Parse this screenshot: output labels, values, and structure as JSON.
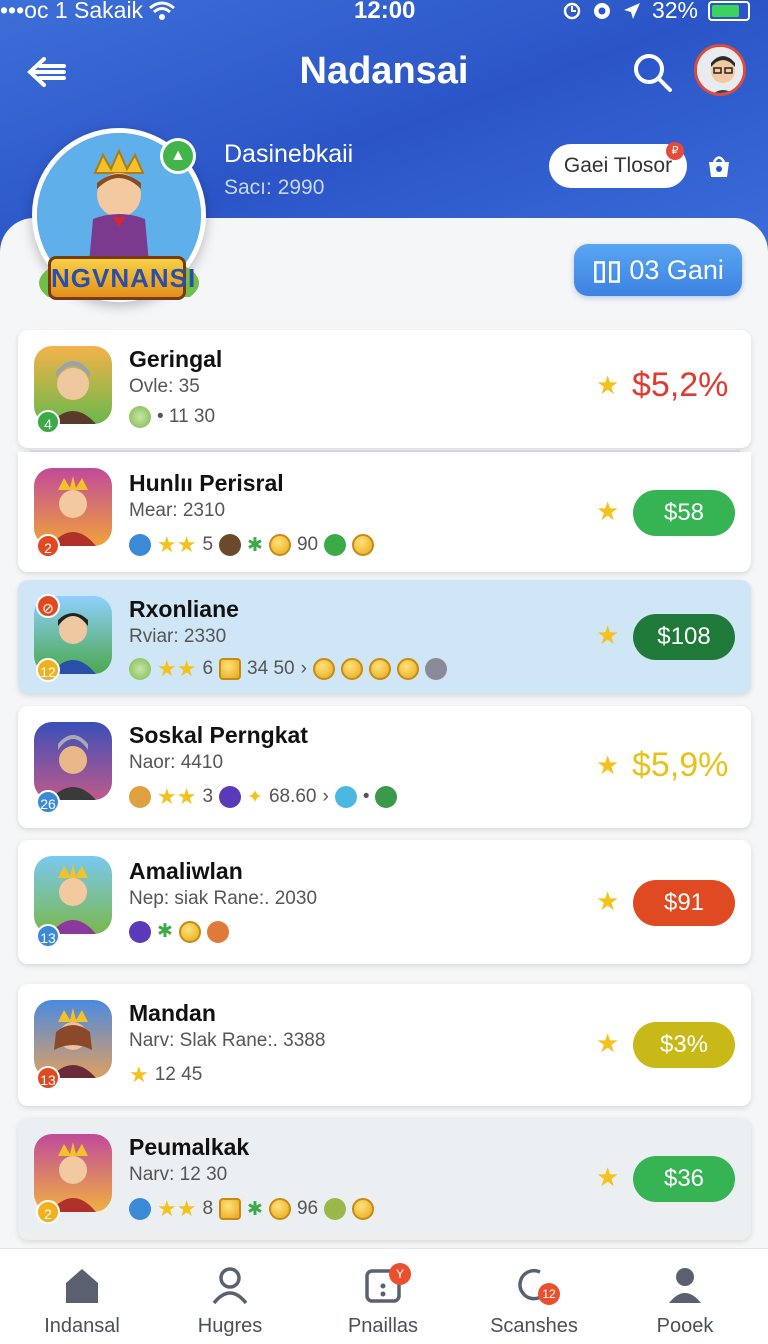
{
  "status_bar": {
    "carrier": "•••oc 1 Sakaik",
    "time": "12:00",
    "battery": "32%"
  },
  "header": {
    "title": "Nadansai"
  },
  "profile": {
    "name": "Dasinebkaii",
    "sub": "Sacı: 2990",
    "logo_text": "NGVNANSI",
    "pill_label": "Gaei Tlosor",
    "games_button": "03 Gani"
  },
  "items": [
    {
      "name": "Geringal",
      "sub": "Ovle: 35",
      "meta": "• 11 30",
      "rank": "4",
      "price": "$5,2%",
      "price_style": "text"
    },
    {
      "name": "Hunlıı Perisral",
      "sub": "Mear: 2310",
      "meta1": "5",
      "meta2": "90",
      "rank": "2",
      "price": "$58",
      "price_style": "button"
    },
    {
      "name": "Rxonliane",
      "sub": "Rviar: 2330",
      "meta1": "6",
      "meta2": "34 50",
      "rank": "12",
      "price": "$108",
      "price_style": "button"
    },
    {
      "name": "Soskal Perngkat",
      "sub": "Naor: 4410",
      "meta1": "3",
      "meta2": "68.60",
      "rank": "26",
      "price": "$5,9%",
      "price_style": "text"
    },
    {
      "name": "Amaliwlan",
      "sub": "Nep: siak Rane:. 2030",
      "rank": "13",
      "price": "$91",
      "price_style": "button"
    },
    {
      "name": "Mandan",
      "sub": "Narv: Slak Rane:. 3388",
      "meta1": "12 45",
      "rank": "13",
      "price": "$3%",
      "price_style": "button"
    },
    {
      "name": "Peumalkak",
      "sub": "Narv: 12 30",
      "meta1": "8",
      "meta2": "96",
      "rank": "2",
      "price": "$36",
      "price_style": "button"
    }
  ],
  "tabs": [
    {
      "label": "Indansal",
      "icon": "home-icon"
    },
    {
      "label": "Hugres",
      "icon": "user-icon"
    },
    {
      "label": "Pnaillas",
      "icon": "calendar-icon",
      "badge": "Y"
    },
    {
      "label": "Scanshes",
      "icon": "refresh-icon",
      "badge": "12"
    },
    {
      "label": "Pooek",
      "icon": "profile-icon"
    }
  ],
  "colors": {
    "header_blue": "#2b55c7",
    "price_red": "#e13a2e",
    "price_yellow_text": "#e6c21a",
    "green": "#36b352",
    "dark_green": "#1f7a3a",
    "orange_red": "#e04a22",
    "olive": "#c8b818"
  }
}
